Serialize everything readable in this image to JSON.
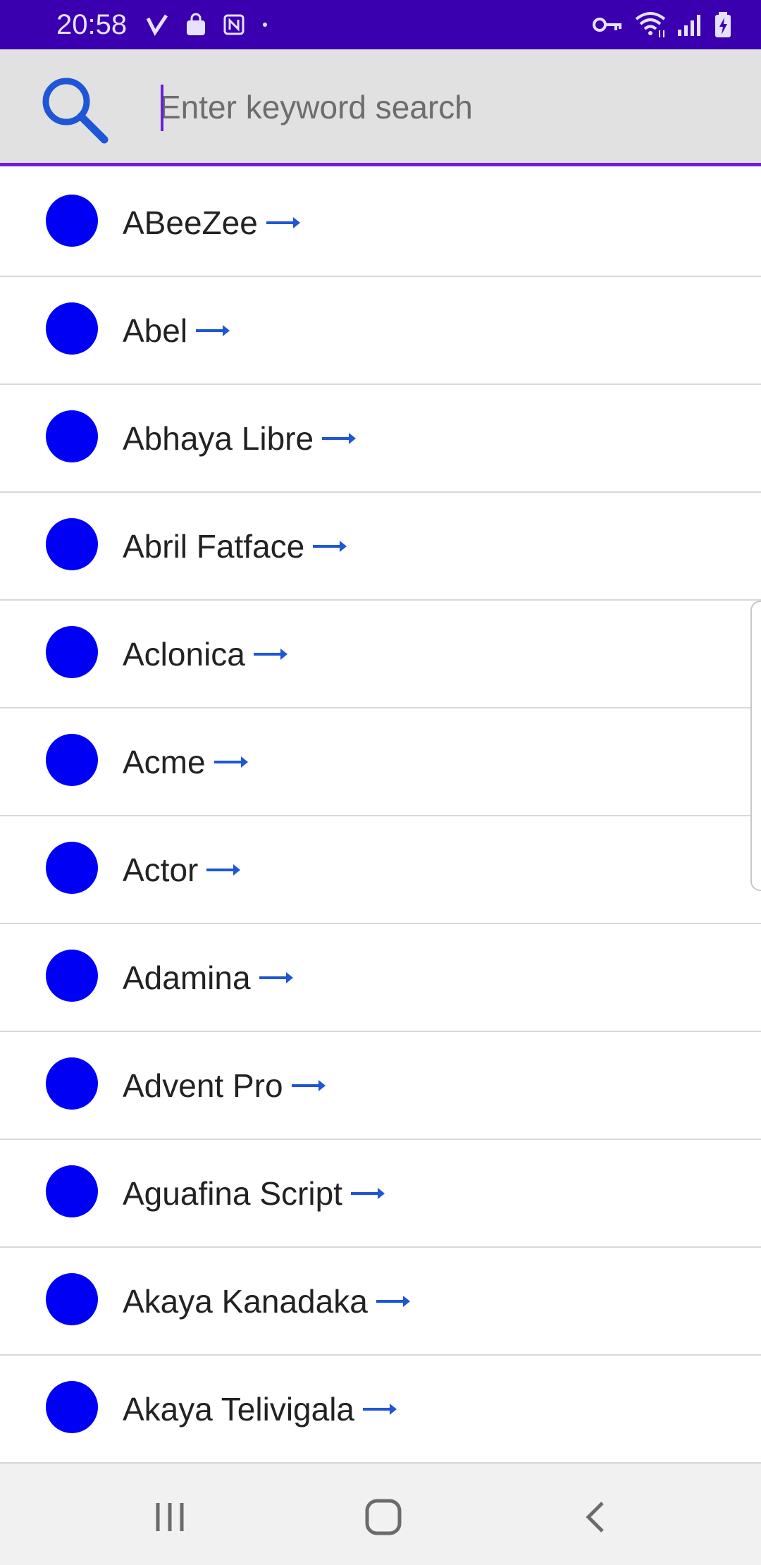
{
  "status_bar": {
    "time": "20:58",
    "left_icons": [
      "v-check-icon",
      "shopping-bag-icon",
      "nfc-icon",
      "dot-icon"
    ],
    "right_icons": [
      "vpn-key-icon",
      "wifi-icon",
      "signal-icon",
      "battery-charging-icon"
    ],
    "background": "#3a00b0"
  },
  "search": {
    "placeholder": "Enter keyword search",
    "value": "",
    "icon": "search-icon",
    "accent": "#6a1fd6"
  },
  "fonts": {
    "items": [
      {
        "label": "ABeeZee"
      },
      {
        "label": "Abel"
      },
      {
        "label": "Abhaya Libre"
      },
      {
        "label": "Abril Fatface"
      },
      {
        "label": "Aclonica"
      },
      {
        "label": "Acme"
      },
      {
        "label": "Actor"
      },
      {
        "label": "Adamina"
      },
      {
        "label": "Advent Pro"
      },
      {
        "label": "Aguafina Script"
      },
      {
        "label": "Akaya Kanadaka"
      },
      {
        "label": "Akaya Telivigala"
      }
    ],
    "dot_color": "#0000f5",
    "arrow_color": "#1f56d6"
  },
  "nav_bar": {
    "buttons": [
      "recent-apps-icon",
      "home-icon",
      "back-icon"
    ]
  }
}
